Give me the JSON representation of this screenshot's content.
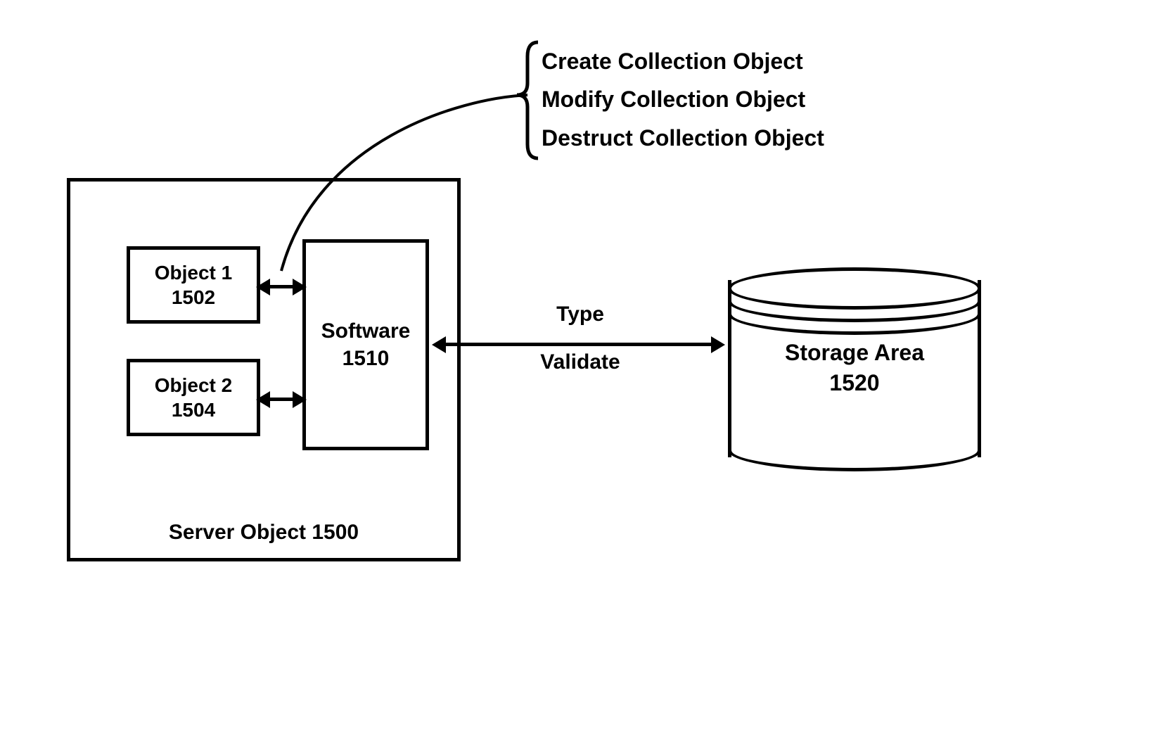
{
  "server": {
    "container_label": "Server Object 1500",
    "object1": {
      "name": "Object 1",
      "ref": "1502"
    },
    "object2": {
      "name": "Object 2",
      "ref": "1504"
    },
    "software": {
      "name": "Software",
      "ref": "1510"
    }
  },
  "storage": {
    "name": "Storage Area",
    "ref": "1520"
  },
  "link": {
    "line1": "Type",
    "line2": "Validate"
  },
  "operations": {
    "create": "Create Collection Object",
    "modify": "Modify Collection Object",
    "destruct": "Destruct Collection Object"
  }
}
